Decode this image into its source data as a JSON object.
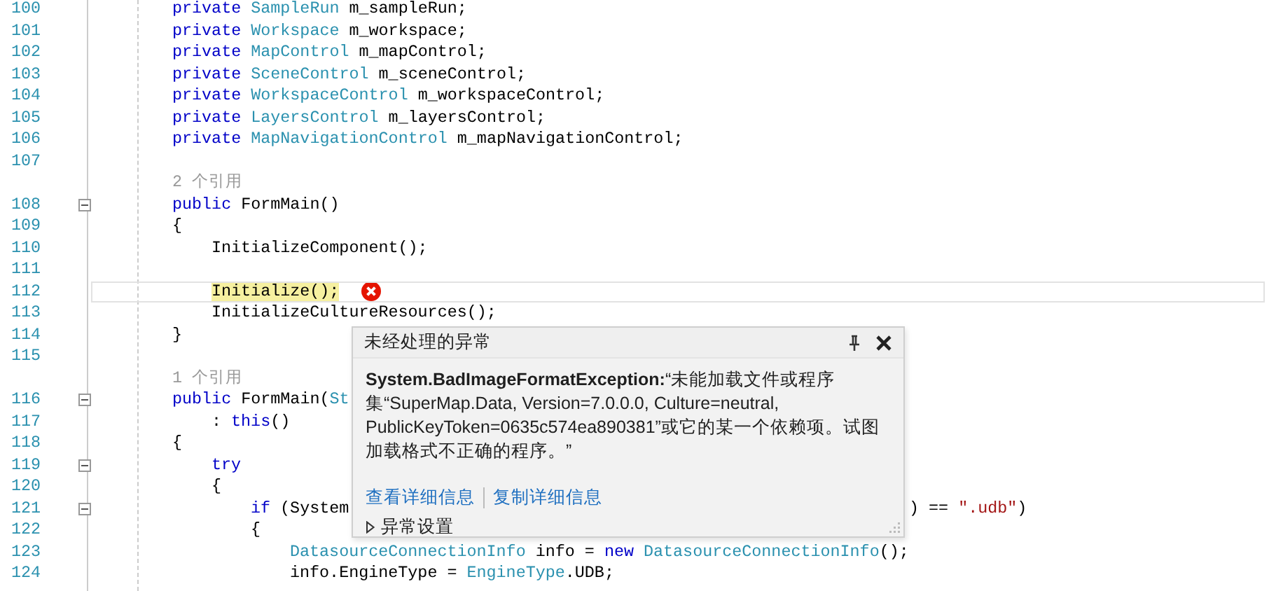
{
  "editor": {
    "lines": [
      {
        "kind": "code",
        "number": "100",
        "collapsible": false,
        "current": false,
        "error": false,
        "tokens": [
          {
            "kind": "keyword",
            "text": "private "
          },
          {
            "kind": "type",
            "text": "SampleRun"
          },
          {
            "kind": "plain",
            "text": " m_sampleRun;"
          }
        ]
      },
      {
        "kind": "code",
        "number": "101",
        "collapsible": false,
        "current": false,
        "error": false,
        "tokens": [
          {
            "kind": "keyword",
            "text": "private "
          },
          {
            "kind": "type",
            "text": "Workspace"
          },
          {
            "kind": "plain",
            "text": " m_workspace;"
          }
        ]
      },
      {
        "kind": "code",
        "number": "102",
        "collapsible": false,
        "current": false,
        "error": false,
        "tokens": [
          {
            "kind": "keyword",
            "text": "private "
          },
          {
            "kind": "type",
            "text": "MapControl"
          },
          {
            "kind": "plain",
            "text": " m_mapControl;"
          }
        ]
      },
      {
        "kind": "code",
        "number": "103",
        "collapsible": false,
        "current": false,
        "error": false,
        "tokens": [
          {
            "kind": "keyword",
            "text": "private "
          },
          {
            "kind": "type",
            "text": "SceneControl"
          },
          {
            "kind": "plain",
            "text": " m_sceneControl;"
          }
        ]
      },
      {
        "kind": "code",
        "number": "104",
        "collapsible": false,
        "current": false,
        "error": false,
        "tokens": [
          {
            "kind": "keyword",
            "text": "private "
          },
          {
            "kind": "type",
            "text": "WorkspaceControl"
          },
          {
            "kind": "plain",
            "text": " m_workspaceControl;"
          }
        ]
      },
      {
        "kind": "code",
        "number": "105",
        "collapsible": false,
        "current": false,
        "error": false,
        "tokens": [
          {
            "kind": "keyword",
            "text": "private "
          },
          {
            "kind": "type",
            "text": "LayersControl"
          },
          {
            "kind": "plain",
            "text": " m_layersControl;"
          }
        ]
      },
      {
        "kind": "code",
        "number": "106",
        "collapsible": false,
        "current": false,
        "error": false,
        "tokens": [
          {
            "kind": "keyword",
            "text": "private "
          },
          {
            "kind": "type",
            "text": "MapNavigationControl"
          },
          {
            "kind": "plain",
            "text": " m_mapNavigationControl;"
          }
        ]
      },
      {
        "kind": "code",
        "number": "107",
        "collapsible": false,
        "current": false,
        "error": false
      },
      {
        "kind": "lens",
        "text": "2 个引用"
      },
      {
        "kind": "code",
        "number": "108",
        "collapsible": true,
        "current": false,
        "error": false,
        "tokens": [
          {
            "kind": "keyword",
            "text": "public "
          },
          {
            "kind": "plain",
            "text": "FormMain()"
          }
        ]
      },
      {
        "kind": "code",
        "number": "109",
        "collapsible": false,
        "current": false,
        "error": false,
        "tokens": [
          {
            "kind": "plain",
            "text": "{"
          }
        ],
        "children": [
          {
            "kind": "code",
            "number": "110",
            "collapsible": false,
            "current": false,
            "error": false,
            "tokens": [
              {
                "kind": "plain",
                "text": "InitializeComponent();"
              }
            ]
          },
          {
            "kind": "code",
            "number": "111",
            "collapsible": false,
            "current": false,
            "error": false
          },
          {
            "kind": "code",
            "number": "112",
            "collapsible": false,
            "current": true,
            "error": true,
            "tokens": [
              {
                "kind": "highlight",
                "text": "Initialize();"
              }
            ]
          },
          {
            "kind": "code",
            "number": "113",
            "collapsible": false,
            "current": false,
            "error": false,
            "tokens": [
              {
                "kind": "plain",
                "text": "InitializeCultureResources();"
              }
            ]
          }
        ]
      },
      {
        "kind": "code",
        "number": "114",
        "collapsible": false,
        "current": false,
        "error": false,
        "tokens": [
          {
            "kind": "plain",
            "text": "}"
          }
        ]
      },
      {
        "kind": "code",
        "number": "115",
        "collapsible": false,
        "current": false,
        "error": false
      },
      {
        "kind": "lens",
        "text": "1 个引用"
      },
      {
        "kind": "code",
        "number": "116",
        "collapsible": true,
        "current": false,
        "error": false,
        "tokens": [
          {
            "kind": "keyword",
            "text": "public "
          },
          {
            "kind": "plain",
            "text": "FormMain("
          },
          {
            "kind": "type",
            "text": "St"
          }
        ],
        "children": [
          {
            "kind": "code",
            "number": "117",
            "collapsible": false,
            "current": false,
            "error": false,
            "tokens": [
              {
                "kind": "plain",
                "text": ": "
              },
              {
                "kind": "keyword",
                "text": "this"
              },
              {
                "kind": "plain",
                "text": "()"
              }
            ]
          }
        ]
      },
      {
        "kind": "code",
        "number": "118",
        "collapsible": false,
        "current": false,
        "error": false,
        "tokens": [
          {
            "kind": "plain",
            "text": "{"
          }
        ],
        "children": [
          {
            "kind": "code",
            "number": "119",
            "collapsible": true,
            "current": false,
            "error": false,
            "tokens": [
              {
                "kind": "keyword",
                "text": "try"
              }
            ]
          },
          {
            "kind": "code",
            "number": "120",
            "collapsible": false,
            "current": false,
            "error": false,
            "tokens": [
              {
                "kind": "plain",
                "text": "{"
              }
            ],
            "children": [
              {
                "kind": "code",
                "number": "121",
                "collapsible": true,
                "current": false,
                "error": false,
                "tokens": [
                  {
                    "kind": "keyword",
                    "text": "if"
                  },
                  {
                    "kind": "plain",
                    "text": " (System"
                  }
                ],
                "tail": [
                  {
                    "kind": "plain",
                    "text": ") == "
                  },
                  {
                    "kind": "string",
                    "text": "\".udb\""
                  },
                  {
                    "kind": "plain",
                    "text": ")"
                  }
                ]
              },
              {
                "kind": "code",
                "number": "122",
                "collapsible": false,
                "current": false,
                "error": false,
                "tokens": [
                  {
                    "kind": "plain",
                    "text": "{"
                  }
                ],
                "children": [
                  {
                    "kind": "code",
                    "number": "123",
                    "collapsible": false,
                    "current": false,
                    "error": false,
                    "tokens": [
                      {
                        "kind": "type",
                        "text": "DatasourceConnectionInfo"
                      },
                      {
                        "kind": "plain",
                        "text": " info = "
                      },
                      {
                        "kind": "keyword",
                        "text": "new "
                      },
                      {
                        "kind": "type",
                        "text": "DatasourceConnectionInfo"
                      },
                      {
                        "kind": "plain",
                        "text": "();"
                      }
                    ]
                  },
                  {
                    "kind": "code",
                    "number": "124",
                    "collapsible": false,
                    "current": false,
                    "error": false,
                    "tokens": [
                      {
                        "kind": "plain",
                        "text": "info.EngineType = "
                      },
                      {
                        "kind": "type",
                        "text": "EngineType"
                      },
                      {
                        "kind": "plain",
                        "text": ".UDB;"
                      }
                    ]
                  }
                ]
              }
            ]
          }
        ]
      }
    ]
  },
  "exception_popup": {
    "title": "未经处理的异常",
    "message": "**System.BadImageFormatException:**“未能加载文件或程序集“SuperMap.Data, Version=7.0.0.0, Culture=neutral, PublicKeyToken=0635c574ea890381”或它的某一个依赖项。试图加载格式不正确的程序。”",
    "links": [
      "查看详细信息",
      "复制详细信息"
    ],
    "settings": {
      "label": "异常设置",
      "expanded": false
    }
  }
}
